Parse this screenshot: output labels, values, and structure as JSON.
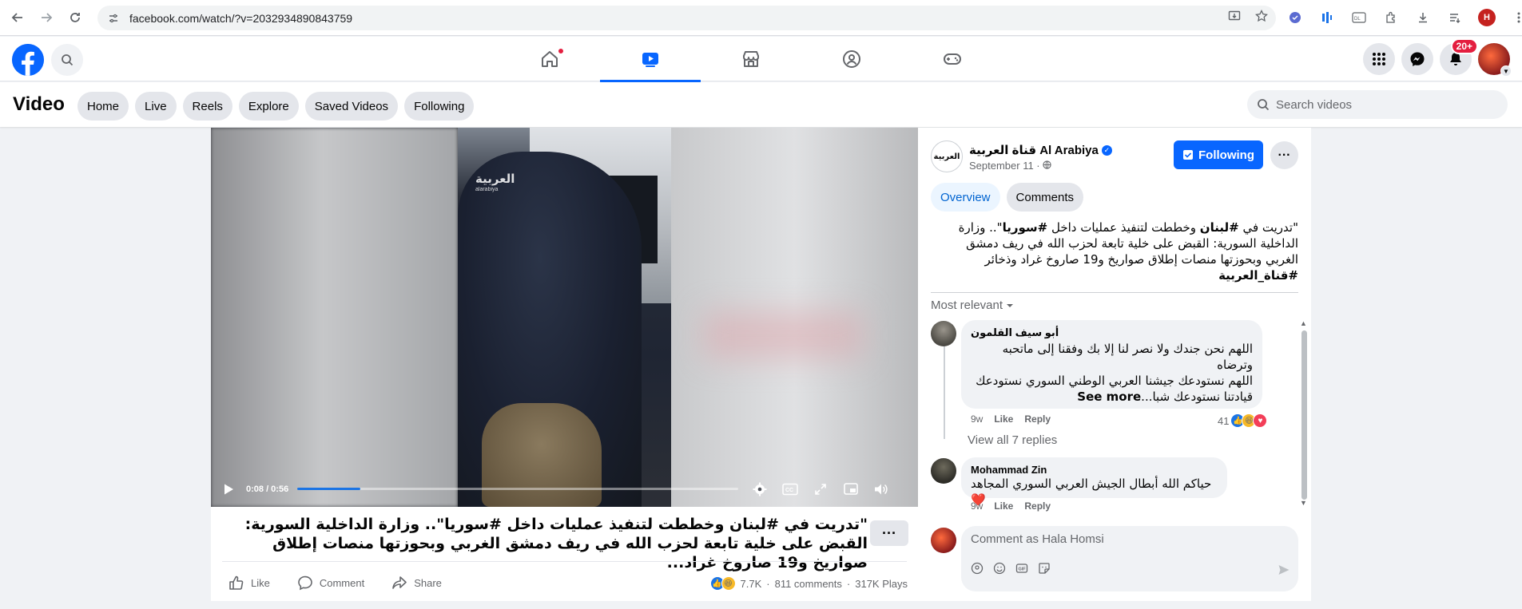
{
  "browser": {
    "url": "facebook.com/watch/?v=2032934890843759",
    "profile_letter": "H"
  },
  "nav": {
    "notification_count": "20+"
  },
  "video_header": {
    "title": "Video",
    "pills": [
      "Home",
      "Live",
      "Reels",
      "Explore",
      "Saved Videos",
      "Following"
    ],
    "search_placeholder": "Search videos"
  },
  "player": {
    "time": "0:08 / 0:56",
    "progress_fraction": 0.143,
    "watermark": "العربية",
    "watermark_sub": "alarabiya"
  },
  "video_caption": "\"تدريت في #لبنان وخططت لتنفيذ عمليات داخل #سوريا\".. وزارة الداخلية السورية: القبض على خلية تابعة لحزب الله في ريف دمشق الغربي وبحوزتها منصات إطلاق صواريخ و19 صاروخ غراد...",
  "actions": {
    "like": "Like",
    "comment": "Comment",
    "share": "Share"
  },
  "stats": {
    "reactions": "7.7K",
    "comments": "811 comments",
    "plays": "317K Plays",
    "separator": "·"
  },
  "page": {
    "name": "قناة العربية Al Arabiya",
    "avatar_text": "العربية",
    "date": "September 11 · ",
    "follow_label": "Following"
  },
  "tabs": {
    "overview": "Overview",
    "comments": "Comments"
  },
  "post": {
    "line1_pre": "\"تدريت في ",
    "tag1": "#لبنان",
    "line1_mid": " وخططت لتنفيذ عمليات داخل ",
    "tag2": "#سوريا",
    "line1_post": "\".. وزارة الداخلية السورية: القبض على خلية تابعة لحزب الله في ريف دمشق الغربي وبحوزتها منصات إطلاق صواريخ و19 صاروخ غراد وذخائر",
    "tag3": "#قناة_العربية"
  },
  "sort_label": "Most relevant",
  "comments": [
    {
      "author": "أبو سيف القلمون",
      "text": "اللهم نحن جندك ولا نصر لنا إلا بك وفقنا إلى ماتحبه وترضاه\nاللهم نستودعك جيشنا العربي الوطني السوري نستودعك قيادتنا نستودعك شبا...",
      "see_more": "See more",
      "time": "9w",
      "like": "Like",
      "reply": "Reply",
      "reaction_count": "41",
      "view_replies": "View all 7 replies"
    },
    {
      "author": "Mohammad Zin",
      "text": "حياكم الله أبطال الجيش العربي السوري المجاهد ❤️",
      "time": "9w",
      "like": "Like",
      "reply": "Reply"
    }
  ],
  "write_comment": {
    "placeholder": "Comment as Hala Homsi"
  },
  "colors": {
    "fb_blue": "#0866ff",
    "progress_blue": "#1b74e4",
    "notification_red": "#e41e3f"
  },
  "icons": [
    "back-icon",
    "forward-icon",
    "reload-icon",
    "home-icon",
    "video-icon",
    "marketplace-icon",
    "groups-icon",
    "gaming-icon",
    "menu-grid-icon",
    "messenger-icon",
    "bell-icon"
  ]
}
